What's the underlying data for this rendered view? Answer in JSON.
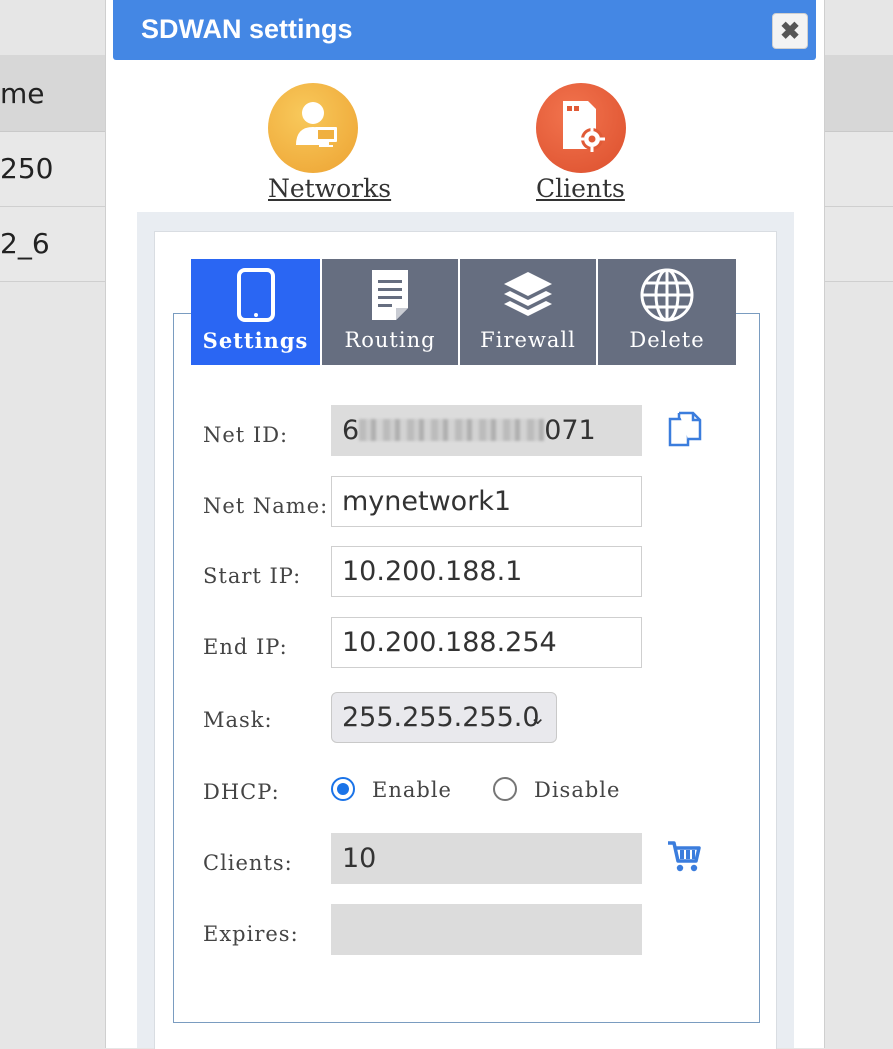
{
  "background": {
    "header_text": "me",
    "rows": [
      "250",
      "2_6"
    ]
  },
  "modal": {
    "title": "SDWAN settings",
    "close_label": "✖",
    "nav": {
      "networks_label": "Networks",
      "clients_label": "Clients"
    },
    "tabs": [
      {
        "label": "Settings",
        "icon": "phone-icon"
      },
      {
        "label": "Routing",
        "icon": "document-icon"
      },
      {
        "label": "Firewall",
        "icon": "layers-icon"
      },
      {
        "label": "Delete",
        "icon": "globe-icon"
      }
    ],
    "form": {
      "net_id_label": "Net ID:",
      "net_id_start": "6",
      "net_id_end": "071",
      "net_name_label": "Net Name:",
      "net_name_value": "mynetwork1",
      "start_ip_label": "Start IP:",
      "start_ip_value": "10.200.188.1",
      "end_ip_label": "End IP:",
      "end_ip_value": "10.200.188.254",
      "mask_label": "Mask:",
      "mask_value": "255.255.255.0",
      "dhcp_label": "DHCP:",
      "dhcp_enable": "Enable",
      "dhcp_disable": "Disable",
      "clients_label": "Clients:",
      "clients_value": "10",
      "expires_label": "Expires:",
      "expires_value": ""
    },
    "colors": {
      "titlebar": "#4487e4",
      "tab_active": "#2a66f3",
      "tab_inactive": "#666e80",
      "icon_blue": "#3b7ddd"
    }
  }
}
